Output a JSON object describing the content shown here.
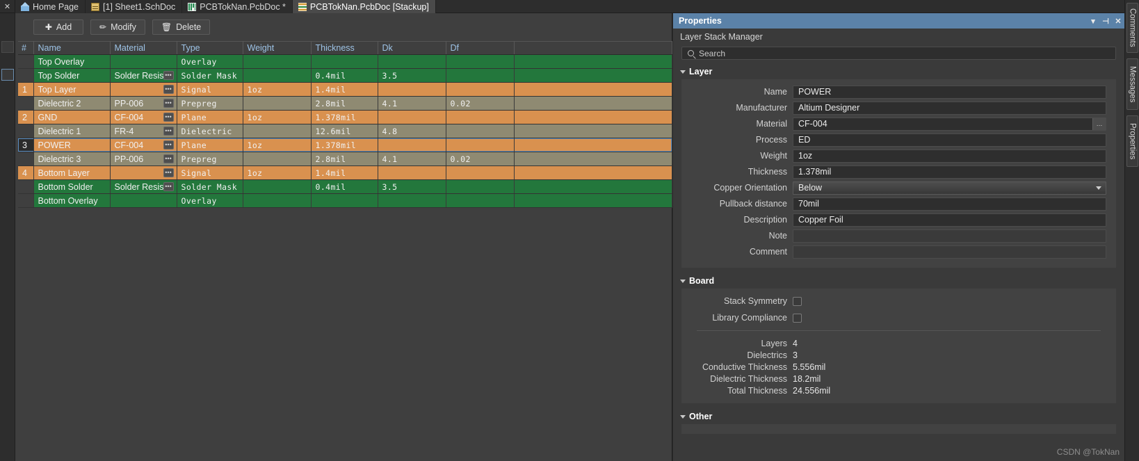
{
  "tabbar": {
    "close_label": "✕",
    "tabs": [
      {
        "label": "Home Page",
        "icon": "home-icon",
        "active": false
      },
      {
        "label": "[1] Sheet1.SchDoc",
        "icon": "schematic-doc-icon",
        "active": false
      },
      {
        "label": "PCBTokNan.PcbDoc *",
        "icon": "pcb-doc-icon",
        "active": false
      },
      {
        "label": "PCBTokNan.PcbDoc [Stackup]",
        "icon": "stackup-doc-icon",
        "active": true
      }
    ]
  },
  "toolbar": {
    "add_label": "Add",
    "add_icon": "plus-icon",
    "modify_label": "Modify",
    "modify_icon": "pencil-icon",
    "delete_label": "Delete",
    "delete_icon": "trash-icon"
  },
  "table": {
    "columns": [
      "#",
      "Name",
      "Material",
      "Type",
      "Weight",
      "Thickness",
      "Dk",
      "Df",
      ""
    ],
    "rows": [
      {
        "idx": "",
        "name": "Top Overlay",
        "material": "",
        "has_mat_btn": false,
        "type": "Overlay",
        "weight": "",
        "thickness": "",
        "dk": "",
        "df": "",
        "style": "green",
        "selected": false
      },
      {
        "idx": "",
        "name": "Top Solder",
        "material": "Solder Resist",
        "has_mat_btn": true,
        "type": "Solder Mask",
        "weight": "",
        "thickness": "0.4mil",
        "dk": "3.5",
        "df": "",
        "style": "green",
        "selected": false
      },
      {
        "idx": "1",
        "name": "Top Layer",
        "material": "",
        "has_mat_btn": true,
        "type": "Signal",
        "weight": "1oz",
        "thickness": "1.4mil",
        "dk": "",
        "df": "",
        "style": "orange",
        "selected": false
      },
      {
        "idx": "",
        "name": "Dielectric 2",
        "material": "PP-006",
        "has_mat_btn": true,
        "type": "Prepreg",
        "weight": "",
        "thickness": "2.8mil",
        "dk": "4.1",
        "df": "0.02",
        "style": "diel",
        "selected": false
      },
      {
        "idx": "2",
        "name": "GND",
        "material": "CF-004",
        "has_mat_btn": true,
        "type": "Plane",
        "weight": "1oz",
        "thickness": "1.378mil",
        "dk": "",
        "df": "",
        "style": "orange",
        "selected": false
      },
      {
        "idx": "",
        "name": "Dielectric 1",
        "material": "FR-4",
        "has_mat_btn": true,
        "type": "Dielectric",
        "weight": "",
        "thickness": "12.6mil",
        "dk": "4.8",
        "df": "",
        "style": "diel",
        "selected": false
      },
      {
        "idx": "3",
        "name": "POWER",
        "material": "CF-004",
        "has_mat_btn": true,
        "type": "Plane",
        "weight": "1oz",
        "thickness": "1.378mil",
        "dk": "",
        "df": "",
        "style": "orange",
        "selected": true
      },
      {
        "idx": "",
        "name": "Dielectric 3",
        "material": "PP-006",
        "has_mat_btn": true,
        "type": "Prepreg",
        "weight": "",
        "thickness": "2.8mil",
        "dk": "4.1",
        "df": "0.02",
        "style": "diel",
        "selected": false
      },
      {
        "idx": "4",
        "name": "Bottom Layer",
        "material": "",
        "has_mat_btn": true,
        "type": "Signal",
        "weight": "1oz",
        "thickness": "1.4mil",
        "dk": "",
        "df": "",
        "style": "orange",
        "selected": false
      },
      {
        "idx": "",
        "name": "Bottom Solder",
        "material": "Solder Resist",
        "has_mat_btn": true,
        "type": "Solder Mask",
        "weight": "",
        "thickness": "0.4mil",
        "dk": "3.5",
        "df": "",
        "style": "green",
        "selected": false
      },
      {
        "idx": "",
        "name": "Bottom Overlay",
        "material": "",
        "has_mat_btn": false,
        "type": "Overlay",
        "weight": "",
        "thickness": "",
        "dk": "",
        "df": "",
        "style": "green",
        "selected": false
      }
    ]
  },
  "properties": {
    "title": "Properties",
    "subtitle": "Layer Stack Manager",
    "titlebar_icons": {
      "dropdown": "chevron-down-icon",
      "pin": "pin-icon",
      "close": "close-icon"
    },
    "search": {
      "placeholder": "Search",
      "value": "",
      "icon": "search-icon"
    },
    "layer": {
      "section_label": "Layer",
      "fields": [
        {
          "label": "Name",
          "value": "POWER",
          "kind": "text"
        },
        {
          "label": "Manufacturer",
          "value": "Altium Designer",
          "kind": "text"
        },
        {
          "label": "Material",
          "value": "CF-004",
          "kind": "text-button",
          "button": "…"
        },
        {
          "label": "Process",
          "value": "ED",
          "kind": "text"
        },
        {
          "label": "Weight",
          "value": "1oz",
          "kind": "text"
        },
        {
          "label": "Thickness",
          "value": "1.378mil",
          "kind": "text"
        },
        {
          "label": "Copper Orientation",
          "value": "Below",
          "kind": "select"
        },
        {
          "label": "Pullback distance",
          "value": "70mil",
          "kind": "text"
        },
        {
          "label": "Description",
          "value": "Copper Foil",
          "kind": "text"
        },
        {
          "label": "Note",
          "value": "",
          "kind": "text"
        },
        {
          "label": "Comment",
          "value": "",
          "kind": "text"
        }
      ]
    },
    "board": {
      "section_label": "Board",
      "checkboxes": [
        {
          "label": "Stack Symmetry",
          "checked": false
        },
        {
          "label": "Library Compliance",
          "checked": false
        }
      ],
      "info": [
        {
          "label": "Layers",
          "value": "4"
        },
        {
          "label": "Dielectrics",
          "value": "3"
        },
        {
          "label": "Conductive Thickness",
          "value": "5.556mil"
        },
        {
          "label": "Dielectric Thickness",
          "value": "18.2mil"
        },
        {
          "label": "Total Thickness",
          "value": "24.556mil"
        }
      ]
    },
    "other": {
      "section_label": "Other"
    }
  },
  "right_tabs": [
    {
      "label": "Comments"
    },
    {
      "label": "Messages"
    },
    {
      "label": "Properties"
    }
  ],
  "watermark": "CSDN @TokNan",
  "colors": {
    "accent": "#5b82a8",
    "green_row": "#23773c",
    "orange_row": "#d9914f",
    "dielectric_row": "#8f8a72",
    "selection": "#5b8fc4"
  }
}
